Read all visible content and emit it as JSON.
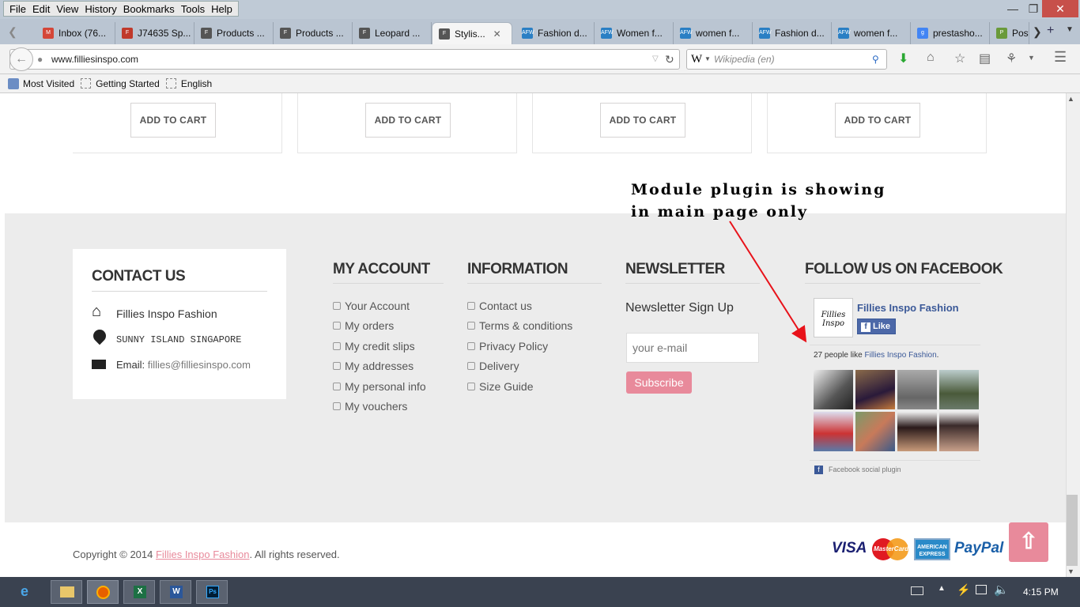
{
  "menubar": {
    "items": [
      "File",
      "Edit",
      "View",
      "History",
      "Bookmarks",
      "Tools",
      "Help"
    ]
  },
  "tabs": [
    {
      "label": "Inbox (76...",
      "icon": "gmail-icon",
      "color": "#d44638",
      "glyph": "M"
    },
    {
      "label": "J74635 Sp...",
      "icon": "f-site-icon",
      "color": "#c0392b",
      "glyph": "F"
    },
    {
      "label": "Products ...",
      "icon": "fillies-icon",
      "color": "#555",
      "glyph": "F"
    },
    {
      "label": "Products ...",
      "icon": "fillies-icon",
      "color": "#555",
      "glyph": "F"
    },
    {
      "label": "Leopard ...",
      "icon": "fillies-icon",
      "color": "#555",
      "glyph": "F"
    },
    {
      "label": "Stylis...",
      "icon": "fillies-icon",
      "color": "#555",
      "glyph": "F",
      "active": true
    },
    {
      "label": "Fashion d...",
      "icon": "afw-icon",
      "color": "#2a7fc4",
      "glyph": "AFW"
    },
    {
      "label": "Women f...",
      "icon": "afw-icon",
      "color": "#2a7fc4",
      "glyph": "AFW"
    },
    {
      "label": "women f...",
      "icon": "afw-icon",
      "color": "#2a7fc4",
      "glyph": "AFW"
    },
    {
      "label": "Fashion d...",
      "icon": "afw-icon",
      "color": "#2a7fc4",
      "glyph": "AFW"
    },
    {
      "label": "women f...",
      "icon": "afw-icon",
      "color": "#2a7fc4",
      "glyph": "AFW"
    },
    {
      "label": "prestasho...",
      "icon": "google-icon",
      "color": "#4285f4",
      "glyph": "g"
    },
    {
      "label": "Post",
      "icon": "post-icon",
      "color": "#6a9a3a",
      "glyph": "P"
    }
  ],
  "nav": {
    "url": "www.filliesinspo.com",
    "search_placeholder": "Wikipedia (en)",
    "search_engine": "W"
  },
  "bookmarks": [
    "Most Visited",
    "Getting Started",
    "English"
  ],
  "products": {
    "add_to_cart": "ADD TO CART"
  },
  "annotation": {
    "line1": "Module plugin is showing",
    "line2": "in main page only"
  },
  "contact": {
    "title": "CONTACT US",
    "name": "Fillies Inspo Fashion",
    "address": "SUNNY ISLAND SINGAPORE",
    "email_label": "Email:",
    "email": "fillies@filliesinspo.com"
  },
  "account": {
    "title": "MY ACCOUNT",
    "items": [
      "Your Account",
      "My orders",
      "My credit slips",
      "My addresses",
      "My personal info",
      "My vouchers"
    ]
  },
  "information": {
    "title": "INFORMATION",
    "items": [
      "Contact us",
      "Terms & conditions",
      "Privacy Policy",
      "Delivery",
      "Size Guide"
    ]
  },
  "newsletter": {
    "title": "NEWSLETTER",
    "subtitle": "Newsletter Sign Up",
    "placeholder": "your e-mail",
    "button": "Subscribe"
  },
  "facebook": {
    "title": "FOLLOW US ON FACEBOOK",
    "page_name": "Fillies Inspo Fashion",
    "like": "Like",
    "likes_prefix": "27 people like",
    "likes_suffix": ".",
    "plugin": "Facebook social plugin"
  },
  "copyright": {
    "prefix": "Copyright © 2014",
    "brand": "Fillies Inspo Fashion",
    "suffix": ". All rights reserved."
  },
  "payments": {
    "visa": "VISA",
    "mastercard": "MasterCard",
    "amex": "AMERICAN EXPRESS",
    "paypal": "PayPal"
  },
  "taskbar": {
    "time": "4:15 PM"
  },
  "colors": {
    "accent": "#e88a9b",
    "fb_blue": "#3b5998"
  }
}
